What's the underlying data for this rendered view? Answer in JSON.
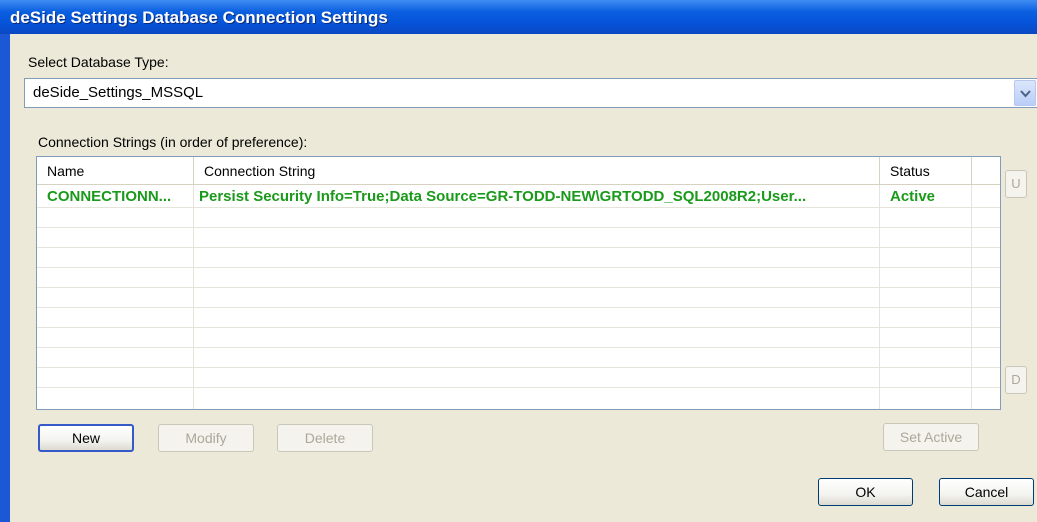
{
  "window": {
    "title": "deSide Settings Database Connection Settings"
  },
  "database_type": {
    "label": "Select Database Type:",
    "selected": "deSide_Settings_MSSQL"
  },
  "connections": {
    "label": "Connection Strings (in order of preference):",
    "columns": {
      "name": "Name",
      "connection_string": "Connection String",
      "status": "Status"
    },
    "rows": [
      {
        "name": "CONNECTIONN...",
        "connection_string": "Persist Security Info=True;Data Source=GR-TODD-NEW\\GRTODD_SQL2008R2;User...",
        "status": "Active"
      }
    ],
    "row_color": "#1a9a1a"
  },
  "buttons": {
    "new": "New",
    "modify": "Modify",
    "delete": "Delete",
    "set_active": "Set Active",
    "move_up": "U",
    "move_down": "D",
    "ok": "OK",
    "cancel": "Cancel"
  },
  "colors": {
    "titlebar": "#0653d8",
    "frame": "#1c57d6",
    "dialog_bg": "#ece9d8"
  }
}
